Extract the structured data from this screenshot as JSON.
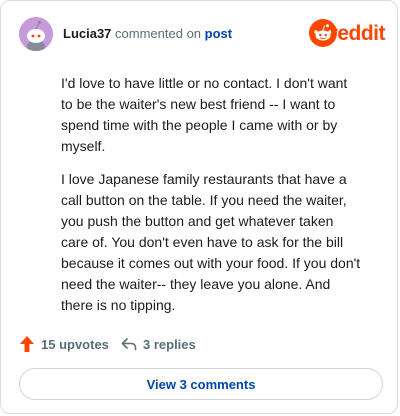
{
  "comment": {
    "username": "Lucia37",
    "action_text": "commented on",
    "post_link": "post",
    "paragraphs": [
      "I'd love to have little or no contact. I don't want to be the waiter's new best friend -- I want to spend time with the people I came with or by myself.",
      "I love Japanese family restaurants that have a call button on the table. If you need the waiter, you push the button and get whatever taken care of. You don't even have to ask for the bill because it comes out with your food. If you don't need the waiter-- they leave you alone. And there is no tipping."
    ]
  },
  "brand": {
    "name": "reddit",
    "color": "#ff4500",
    "icon": "reddit-logo-icon"
  },
  "actions": {
    "upvotes": "15 upvotes",
    "upvote_color": "#ff4500",
    "upvote_icon": "upvote-arrow-icon",
    "replies": "3 replies",
    "reply_icon": "reply-arrow-icon"
  },
  "view_comments": "View 3 comments"
}
